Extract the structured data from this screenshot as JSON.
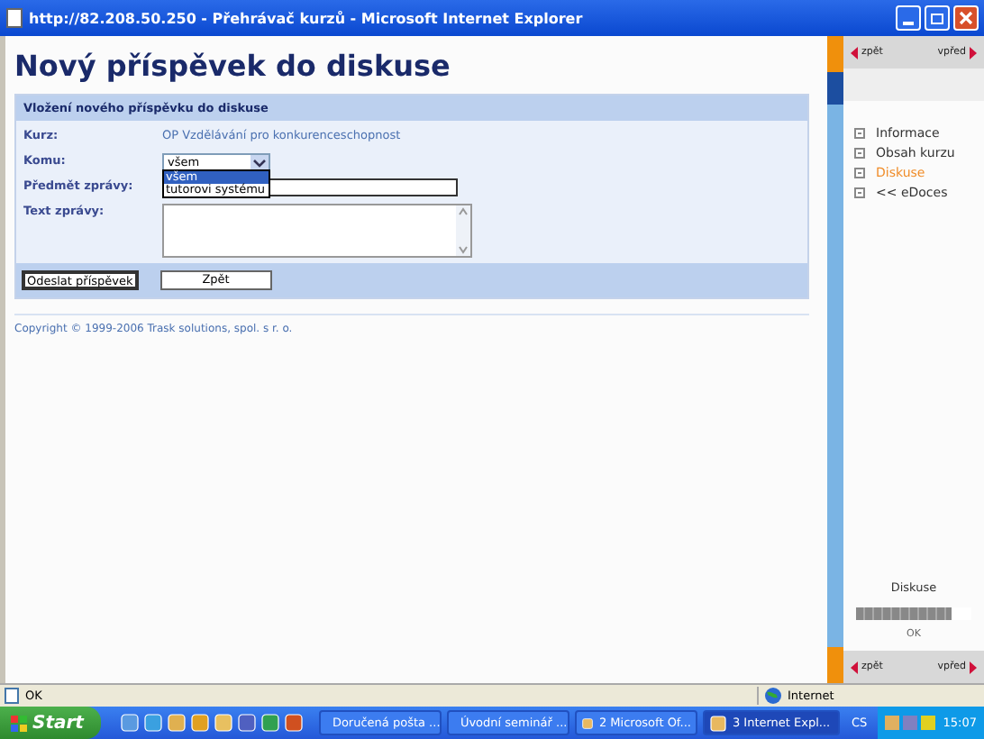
{
  "window": {
    "title": "http://82.208.50.250 - Přehrávač kurzů - Microsoft Internet Explorer"
  },
  "page": {
    "title": "Nový příspěvek do diskuse",
    "form": {
      "header": "Vložení nového příspěvku do diskuse",
      "fields": [
        {
          "kind": "text",
          "label": "Kurz:",
          "value": "OP Vzdělávání pro konkurenceschopnost"
        },
        {
          "kind": "select",
          "label": "Komu:",
          "value": "všem",
          "expanded": true,
          "options": [
            {
              "label": "všem",
              "selected": true
            },
            {
              "label": "tutorovi systému",
              "selected": false
            }
          ]
        },
        {
          "kind": "input",
          "label": "Předmět zprávy:"
        },
        {
          "kind": "textarea",
          "label": "Text zprávy:"
        }
      ],
      "buttons": [
        "Odeslat příspěvek",
        "Zpět"
      ]
    },
    "copyright": "Copyright © 1999-2006 Trask solutions, spol. s r. o."
  },
  "sidebar": {
    "nav_top": [
      "zpět",
      "vpřed"
    ],
    "menu": [
      {
        "label": "Informace",
        "selected": false
      },
      {
        "label": "Obsah kurzu",
        "selected": false
      },
      {
        "label": "Diskuse",
        "selected": true
      },
      {
        "label": "<< eDoces",
        "selected": false
      }
    ],
    "progress": {
      "title": "Diskuse",
      "level": 0.83,
      "status": "OK"
    },
    "nav_bottom": [
      "zpět",
      "vpřed"
    ]
  },
  "status_bar": {
    "text": "OK",
    "zone": "Internet"
  },
  "taskbar": {
    "start": "Start",
    "tasks": [
      {
        "label": "Doručená pošta ...",
        "selected": false
      },
      {
        "label": "Úvodní seminář ...",
        "selected": false
      },
      {
        "label": "2 Microsoft Of...",
        "selected": false
      },
      {
        "label": "3 Internet Expl...",
        "selected": true
      }
    ],
    "language": "CS",
    "time": "15:07"
  }
}
